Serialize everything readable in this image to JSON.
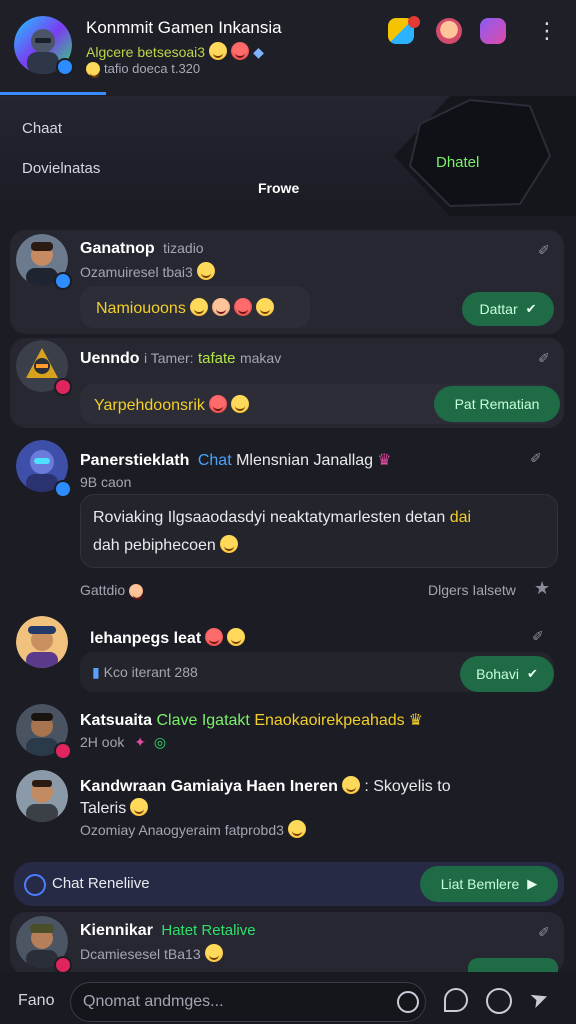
{
  "header": {
    "group_name": "Konmmit Gamen Inkansia",
    "subtitle_1": "Algcere betsesoai3",
    "subtitle_2": "tafio doeca t.320",
    "overflow_icon": "more-vert-icon"
  },
  "banner": {
    "item_1": "Chaat",
    "item_2": "Dovielnatas",
    "center_label": "Frowe",
    "hex_label": "Dhatel"
  },
  "messages": [
    {
      "name": "Ganatnop",
      "name_suffix": "tizadio",
      "sub": "Ozamuiresel tbai3",
      "bubble": "Namiouoons",
      "button": "Dattar"
    },
    {
      "name": "Uenndo",
      "name_suffix": "i Tamer:",
      "name_green": "tafate",
      "name_tail": "makav",
      "bubble": "Yarpehdoonsrik",
      "button": "Pat Rematian"
    },
    {
      "name": "Panerstieklath",
      "name_blue": "Chat",
      "name_tail": "Mlensnian Janallag",
      "sub": "9B caon",
      "body_1": "Roviaking",
      "body_1b": "Ilgsaaodasdyi neaktatymarlesten detan",
      "body_1c": "dai",
      "body_2": "dah pebiphecoen",
      "footer_left": "Gattdio",
      "footer_right": "Dlgers Ialsetw"
    },
    {
      "name": "lehanpegs leat",
      "sub": "Kco iterant 288",
      "button": "Bohavi"
    },
    {
      "name": "Katsuaita",
      "name_green": "Clave Igatakt",
      "name_yellow": "Enaokaoirekpeahads",
      "sub": "2H ook"
    },
    {
      "name": "Kandwraan Gamiaiya Haen Ineren",
      "name_tail": ": Skoyelis to",
      "name_2": "Taleris",
      "sub": "Ozomiay Anaogyeraim fatprobd3"
    },
    {
      "name": "Kiennikar",
      "name_green": "Hatet Retalive",
      "sub": "Dcamiesesel tBa13"
    }
  ],
  "relative_bar": {
    "label": "Chat Reneliive",
    "button": "Liat Bemlere"
  },
  "composer": {
    "left_label": "Fano",
    "placeholder": "Qnomat andmges..."
  }
}
